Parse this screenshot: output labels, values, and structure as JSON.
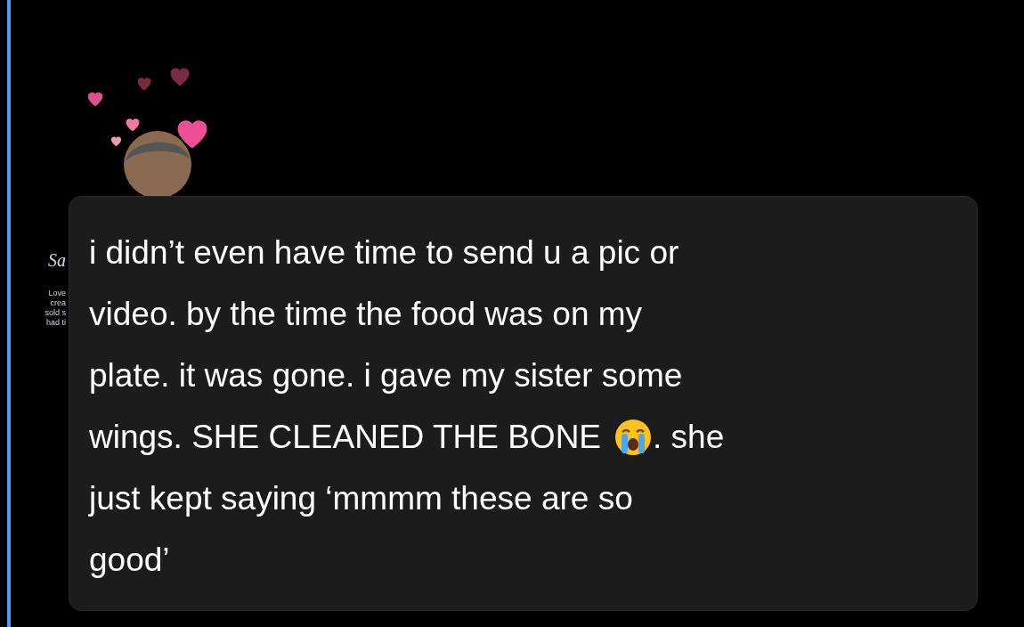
{
  "background_post": {
    "title": "Sa",
    "lines": [
      "Love",
      "crea",
      "sold s",
      "had ti"
    ]
  },
  "message": {
    "lines": [
      {
        "kind": "text",
        "text": "i didn’t even have time to send u a pic or"
      },
      {
        "kind": "text",
        "text": "video. by the time the food was on my"
      },
      {
        "kind": "text",
        "text": "plate. it was gone. i gave my sister some"
      },
      {
        "kind": "emoji",
        "text": "wings. SHE CLEANED THE BONE",
        "text_after": ". she"
      },
      {
        "kind": "text",
        "text": "just kept saying ‘mmmm these are so"
      },
      {
        "kind": "text",
        "text": "good’"
      }
    ]
  }
}
